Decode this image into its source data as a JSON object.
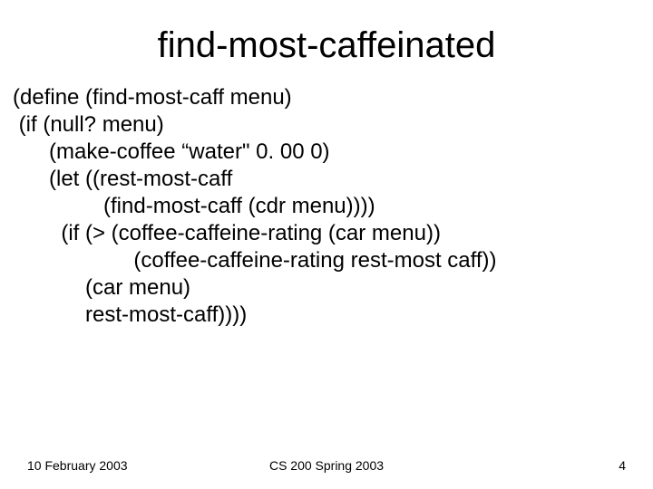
{
  "title": "find-most-caffeinated",
  "code_lines": {
    "l1": "(define (find-most-caff menu)",
    "l2": " (if (null? menu)",
    "l3": "      (make-coffee “water\" 0. 00 0)",
    "l4": "      (let ((rest-most-caff",
    "l5": "               (find-most-caff (cdr menu))))",
    "l6": "        (if (> (coffee-caffeine-rating (car menu))",
    "l7": "                    (coffee-caffeine-rating rest-most caff))",
    "l8": "            (car menu)",
    "l9": "            rest-most-caff))))"
  },
  "footer": {
    "left": "10 February 2003",
    "center": "CS 200 Spring 2003",
    "right": "4"
  }
}
